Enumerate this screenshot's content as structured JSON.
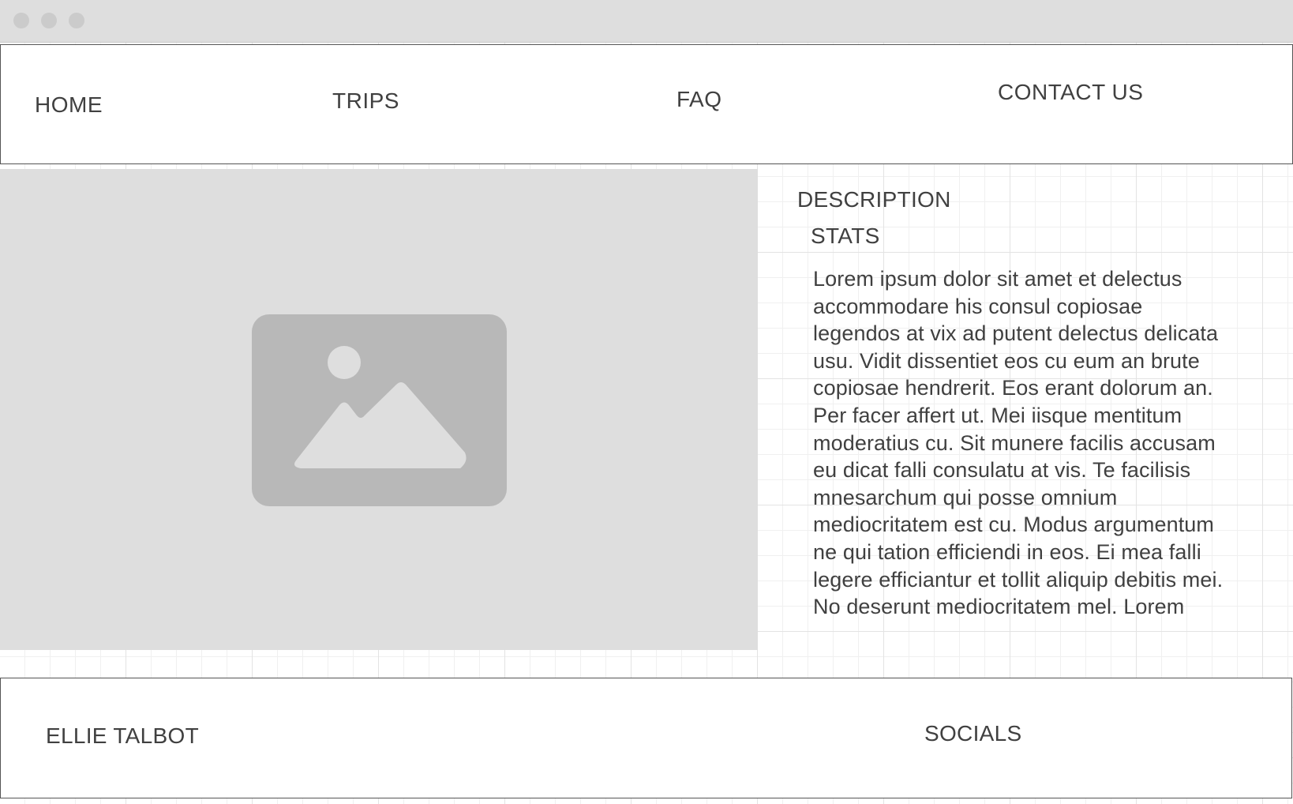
{
  "nav": {
    "home": "HOME",
    "trips": "TRIPS",
    "faq": "FAQ",
    "contact": "CONTACT US"
  },
  "hero": {
    "image_icon": "image-placeholder-icon"
  },
  "details": {
    "description_heading": "DESCRIPTION",
    "stats_heading": "STATS",
    "body": "Lorem ipsum dolor sit amet et delectus\naccommodare his consul copiosae\nlegendos at vix ad putent delectus delicata\nusu. Vidit dissentiet eos cu eum an brute\ncopiosae hendrerit. Eos erant dolorum an.\nPer facer affert ut. Mei iisque mentitum\nmoderatius cu. Sit munere facilis accusam\neu dicat falli consulatu at vis. Te facilisis\nmnesarchum qui posse omnium\nmediocritatem est cu. Modus argumentum\nne qui tation efficiendi in eos. Ei mea falli\nlegere efficiantur et tollit aliquip debitis mei.\nNo deserunt mediocritatem mel. Lorem"
  },
  "footer": {
    "name": "ELLIE TALBOT",
    "socials": "SOCIALS"
  },
  "colors": {
    "text": "#404040",
    "titlebar": "#dedede",
    "placeholder": "#dedede",
    "placeholder_icon": "#b8b8b8",
    "border": "#555555",
    "grid": "#e3e3e3"
  }
}
